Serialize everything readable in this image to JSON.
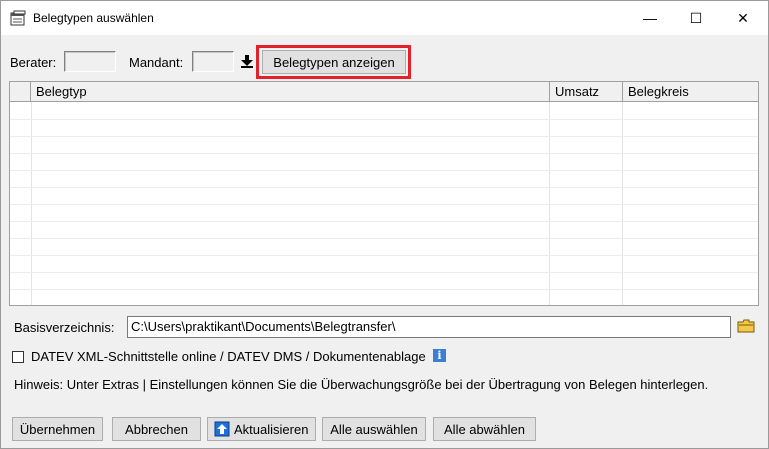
{
  "window": {
    "title": "Belegtypen auswählen",
    "controls": {
      "minimize": "—",
      "maximize": "☐",
      "close": "✕"
    }
  },
  "toolbar": {
    "berater_label": "Berater:",
    "mandant_label": "Mandant:",
    "show_button_label": "Belegtypen anzeigen",
    "download_icon": "download-arrow-icon"
  },
  "table": {
    "columns": [
      "Belegtyp",
      "Umsatz",
      "Belegkreis"
    ]
  },
  "basis": {
    "label": "Basisverzeichnis:",
    "value": "C:\\Users\\praktikant\\Documents\\Belegtransfer\\",
    "folder_icon": "folder-icon"
  },
  "checkbox": {
    "label": "DATEV XML-Schnittstelle online / DATEV DMS / Dokumentenablage",
    "checked": false,
    "info_icon": "info-icon"
  },
  "hint": "Hinweis: Unter Extras | Einstellungen können Sie die Überwachungsgröße bei der Übertragung von Belegen hinterlegen.",
  "buttons": {
    "accept": "Übernehmen",
    "cancel": "Abbrechen",
    "refresh": "Aktualisieren",
    "select_all": "Alle auswählen",
    "deselect_all": "Alle abwählen"
  },
  "colors": {
    "highlight_border": "#e3212a",
    "window_bg": "#f0f0f0",
    "info_icon_bg": "#3c7fd2",
    "folder_icon": "#f2c94c"
  }
}
